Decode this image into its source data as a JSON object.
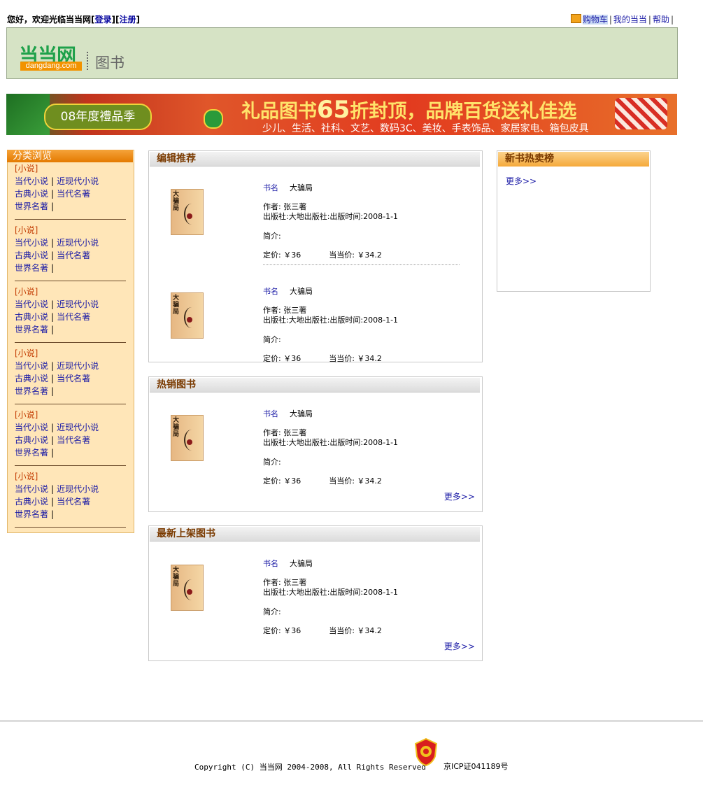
{
  "topbar": {
    "welcome_prefix": "您好，欢迎光临当当网",
    "login": "登录",
    "register": "注册",
    "cart": "购物车",
    "my_dangdang": "我的当当",
    "help": "帮助"
  },
  "header": {
    "logo_cn": "当当网",
    "logo_en": "dangdang.com",
    "section": "图书"
  },
  "banner": {
    "badge": "08年度禮品季",
    "main_prefix": "礼品图书",
    "main_num": "65",
    "main_suffix": "折封顶，品牌百货送礼佳选",
    "sub": "少儿、生活、社科、文艺、数码3C、美妆、手表饰品、家居家电、箱包皮具"
  },
  "sidebar": {
    "title": "分类浏览",
    "categories": [
      {
        "title": "[小说]",
        "rows": [
          [
            "当代小说",
            "近现代小说"
          ],
          [
            "古典小说",
            "当代名著"
          ],
          [
            "世界名著",
            ""
          ]
        ]
      },
      {
        "title": "[小说]",
        "rows": [
          [
            "当代小说",
            "近现代小说"
          ],
          [
            "古典小说",
            "当代名著"
          ],
          [
            "世界名著",
            ""
          ]
        ]
      },
      {
        "title": "[小说]",
        "rows": [
          [
            "当代小说",
            "近现代小说"
          ],
          [
            "古典小说",
            "当代名著"
          ],
          [
            "世界名著",
            ""
          ]
        ]
      },
      {
        "title": "[小说]",
        "rows": [
          [
            "当代小说",
            "近现代小说"
          ],
          [
            "古典小说",
            "当代名著"
          ],
          [
            "世界名著",
            ""
          ]
        ]
      },
      {
        "title": "[小说]",
        "rows": [
          [
            "当代小说",
            "近现代小说"
          ],
          [
            "古典小说",
            "当代名著"
          ],
          [
            "世界名著",
            ""
          ]
        ]
      },
      {
        "title": "[小说]",
        "rows": [
          [
            "当代小说",
            "近现代小说"
          ],
          [
            "古典小说",
            "当代名著"
          ],
          [
            "世界名著",
            ""
          ]
        ]
      }
    ]
  },
  "book": {
    "cover_title": "大骗局",
    "name_label": "书名",
    "name": "大骗局",
    "author": "作者:  张三著",
    "publisher": "出版社:大地出版社:出版时间:2008-1-1",
    "intro": "简介:",
    "list_price": "定价:  ￥36",
    "dd_price": "当当价:  ￥34.2"
  },
  "panels": {
    "editor": "编辑推荐",
    "hot": "热销图书",
    "newest": "最新上架图书",
    "more": "更多>>"
  },
  "right": {
    "title": "新书热卖榜",
    "more": "更多>>"
  },
  "footer": {
    "copyright": "Copyright (C) 当当网 2004-2008, All Rights Reserved",
    "icp": "京ICP证041189号"
  }
}
